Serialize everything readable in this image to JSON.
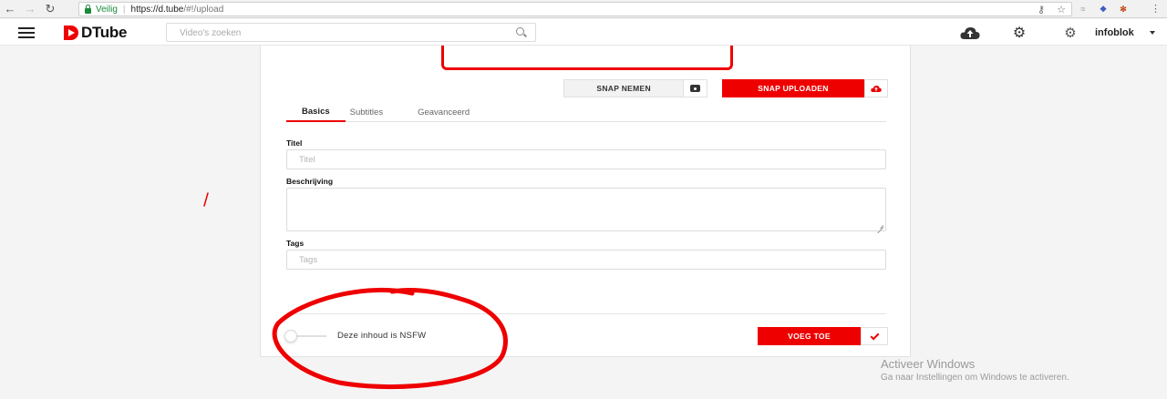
{
  "browser": {
    "secure_label": "Veilig",
    "url_host": "https://d.tube",
    "url_path": "/#!/upload"
  },
  "header": {
    "logo_text": "DTube",
    "search_placeholder": "Video's zoeken",
    "username": "infoblok"
  },
  "snap": {
    "take_label": "SNAP NEMEN",
    "upload_label": "SNAP UPLOADEN"
  },
  "tabs": [
    {
      "label": "Basics",
      "active": true
    },
    {
      "label": "Subtitles",
      "active": false
    },
    {
      "label": "Geavanceerd",
      "active": false
    }
  ],
  "form": {
    "title_label": "Titel",
    "title_placeholder": "Titel",
    "description_label": "Beschrijving",
    "tags_label": "Tags",
    "tags_placeholder": "Tags",
    "nsfw_label": "Deze inhoud is NSFW",
    "nsfw_enabled": false,
    "add_label": "VOEG TOE"
  },
  "watermark": {
    "line1": "Activeer Windows",
    "line2": "Ga naar Instellingen om Windows te activeren."
  },
  "colors": {
    "accent": "#ee0000",
    "annotation": "#e00000"
  },
  "icons": [
    "back-arrow-icon",
    "forward-arrow-icon",
    "reload-icon",
    "lock-icon",
    "key-icon",
    "star-icon",
    "menu-icon",
    "search-icon",
    "upload-cloud-icon",
    "settings-icon",
    "camera-icon",
    "check-icon"
  ]
}
